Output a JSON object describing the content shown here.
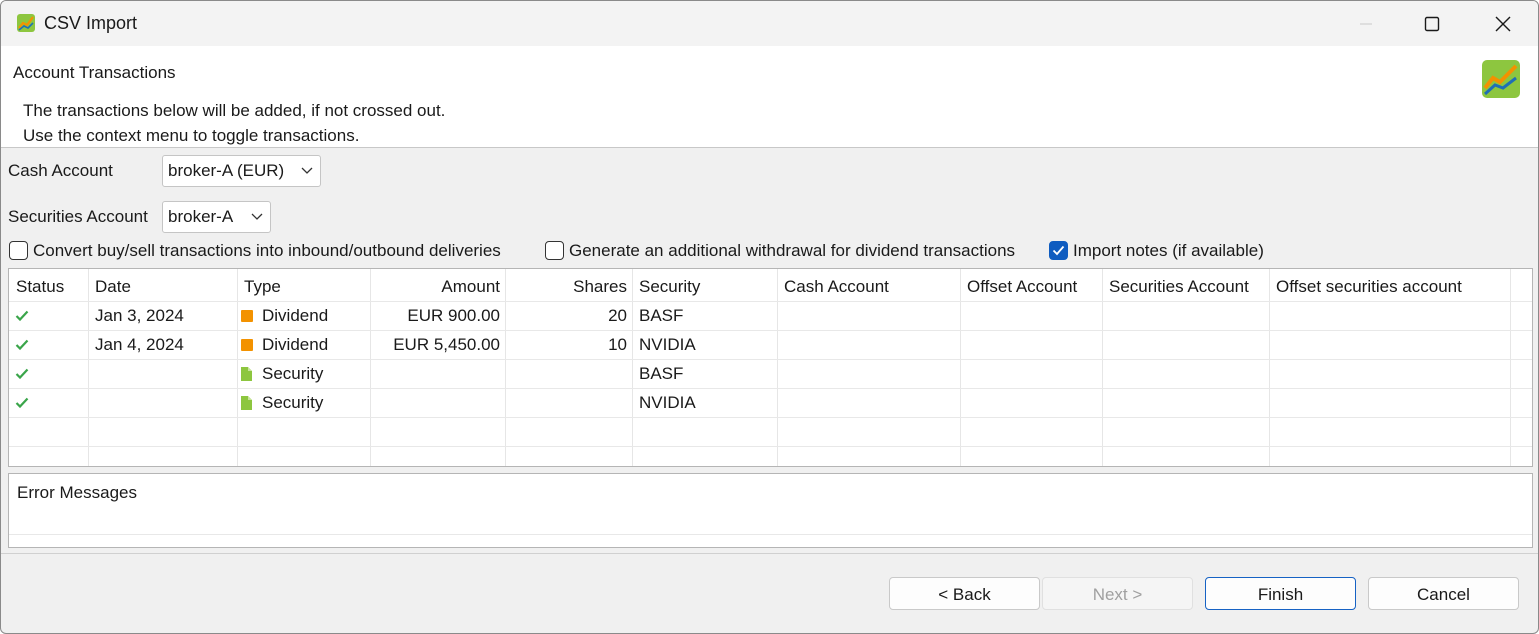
{
  "window": {
    "title": "CSV Import"
  },
  "header": {
    "title": "Account Transactions",
    "description_line1": "The transactions below will be added, if not crossed out.",
    "description_line2": "Use the context menu to toggle transactions."
  },
  "form": {
    "cash_account_label": "Cash Account",
    "cash_account_value": "broker-A (EUR)",
    "securities_account_label": "Securities Account",
    "securities_account_value": "broker-A",
    "options": [
      {
        "label": "Convert buy/sell transactions into inbound/outbound deliveries",
        "checked": false
      },
      {
        "label": "Generate an additional withdrawal for dividend transactions",
        "checked": false
      },
      {
        "label": "Import notes (if available)",
        "checked": true
      }
    ]
  },
  "table": {
    "columns": [
      "Status",
      "Date",
      "Type",
      "Amount",
      "Shares",
      "Security",
      "Cash Account",
      "Offset Account",
      "Securities Account",
      "Offset securities account"
    ],
    "rows": [
      {
        "status": "ok",
        "date": "Jan 3, 2024",
        "type": "Dividend",
        "type_icon": "dividend-icon",
        "amount": "EUR 900.00",
        "shares": "20",
        "security": "BASF",
        "cash_account": "",
        "offset_account": "",
        "securities_account": "",
        "offset_securities_account": ""
      },
      {
        "status": "ok",
        "date": "Jan 4, 2024",
        "type": "Dividend",
        "type_icon": "dividend-icon",
        "amount": "EUR 5,450.00",
        "shares": "10",
        "security": "NVIDIA",
        "cash_account": "",
        "offset_account": "",
        "securities_account": "",
        "offset_securities_account": ""
      },
      {
        "status": "ok",
        "date": "",
        "type": "Security",
        "type_icon": "security-icon",
        "amount": "",
        "shares": "",
        "security": "BASF",
        "cash_account": "",
        "offset_account": "",
        "securities_account": "",
        "offset_securities_account": ""
      },
      {
        "status": "ok",
        "date": "",
        "type": "Security",
        "type_icon": "security-icon",
        "amount": "",
        "shares": "",
        "security": "NVIDIA",
        "cash_account": "",
        "offset_account": "",
        "securities_account": "",
        "offset_securities_account": ""
      }
    ]
  },
  "errors": {
    "title": "Error Messages"
  },
  "buttons": {
    "back": "< Back",
    "next": "Next >",
    "finish": "Finish",
    "cancel": "Cancel"
  },
  "colors": {
    "accent": "#0f5cc0",
    "check_green": "#3aa54a",
    "dividend_orange": "#f39200",
    "security_green": "#8dc63f"
  }
}
